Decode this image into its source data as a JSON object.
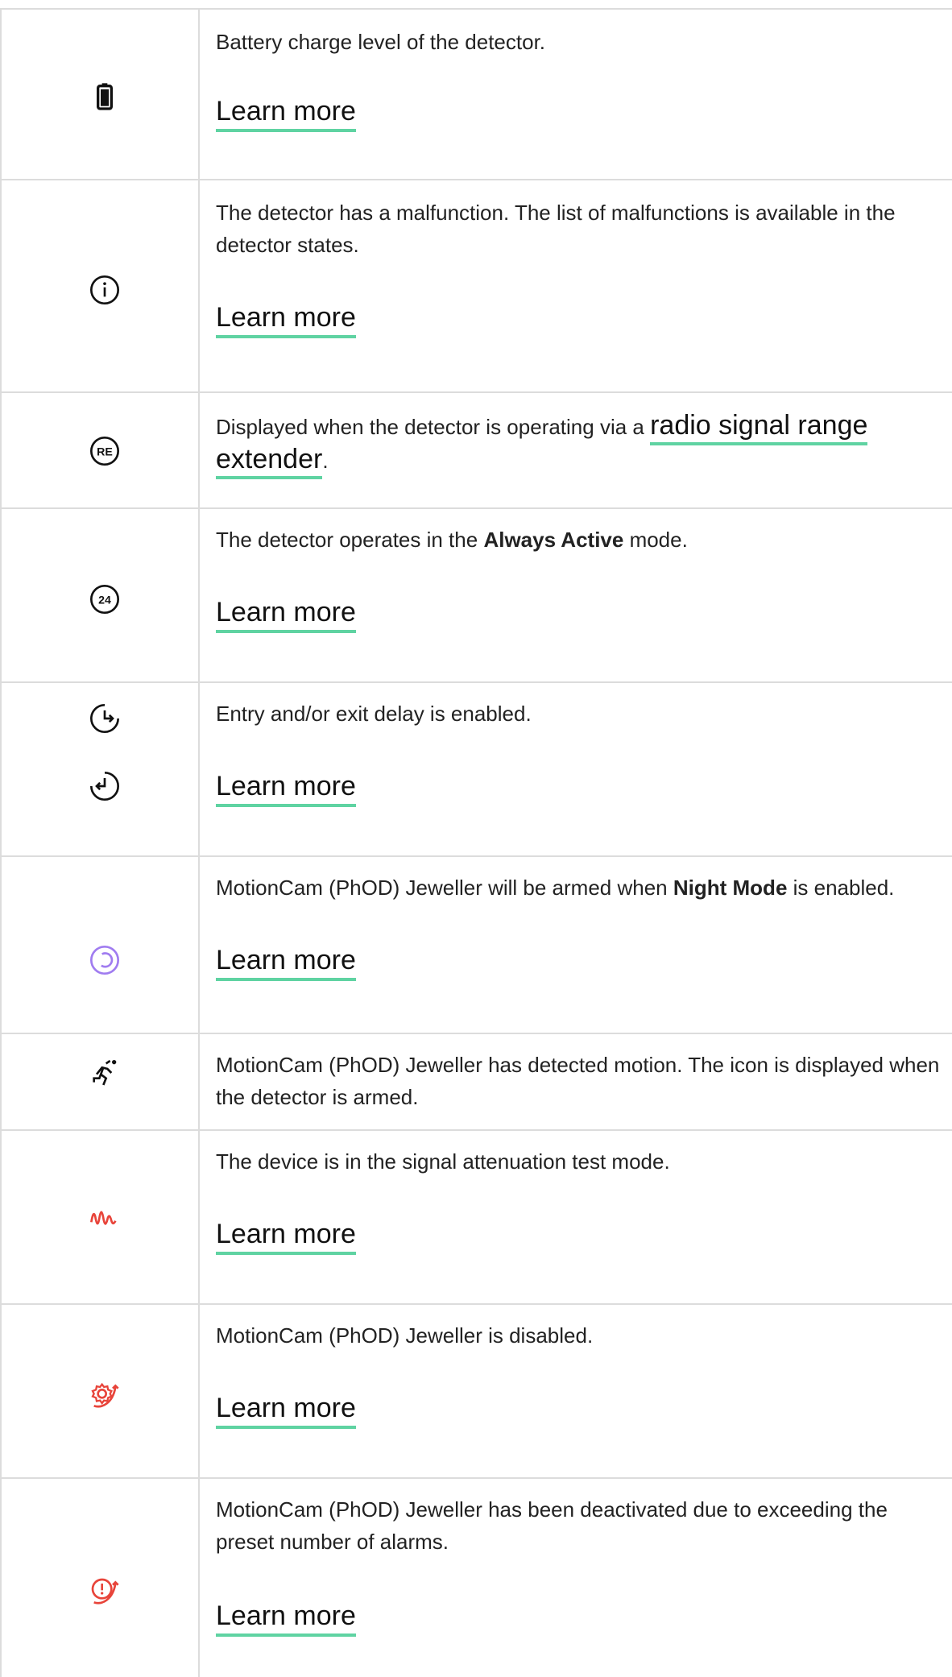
{
  "rows": [
    {
      "icon": "battery-icon",
      "text": "Battery charge level of the detector.",
      "link": "Learn more"
    },
    {
      "icon": "info-icon",
      "text": "The detector has a malfunction. The list of malfunctions is available in the detector states.",
      "link": "Learn more"
    },
    {
      "icon": "re-badge-icon",
      "icon_text": "RE",
      "text_before": "Displayed when the detector is operating via a ",
      "link_inline": "radio signal range extender",
      "text_after": "."
    },
    {
      "icon": "24-badge-icon",
      "icon_text": "24",
      "text_before": "The detector operates in the ",
      "bold": "Always Active",
      "text_after": " mode.",
      "link": "Learn more"
    },
    {
      "icons": [
        "entry-delay-icon",
        "exit-delay-icon"
      ],
      "text": "Entry and/or exit delay is enabled.",
      "link": "Learn more"
    },
    {
      "icon": "night-mode-icon",
      "text_before": "MotionCam (PhOD) Jeweller will be armed when ",
      "bold": "Night Mode",
      "text_after": " is enabled.",
      "link": "Learn more"
    },
    {
      "icon": "motion-detected-icon",
      "text": "MotionCam (PhOD) Jeweller has detected motion. The icon is displayed when the detector is armed."
    },
    {
      "icon": "signal-attenuation-icon",
      "text": "The device is in the signal attenuation test mode.",
      "link": "Learn more"
    },
    {
      "icon": "device-disabled-icon",
      "text": "MotionCam (PhOD) Jeweller is disabled.",
      "link": "Learn more"
    },
    {
      "icon": "deactivated-alarms-icon",
      "text": "MotionCam (PhOD) Jeweller has been deactivated due to exceeding the preset number of alarms.",
      "link": "Learn more"
    }
  ],
  "colors": {
    "accent": "#5fd3a2",
    "night": "#a07cf0",
    "alert": "#e8443a",
    "border": "#dcdcdc"
  }
}
